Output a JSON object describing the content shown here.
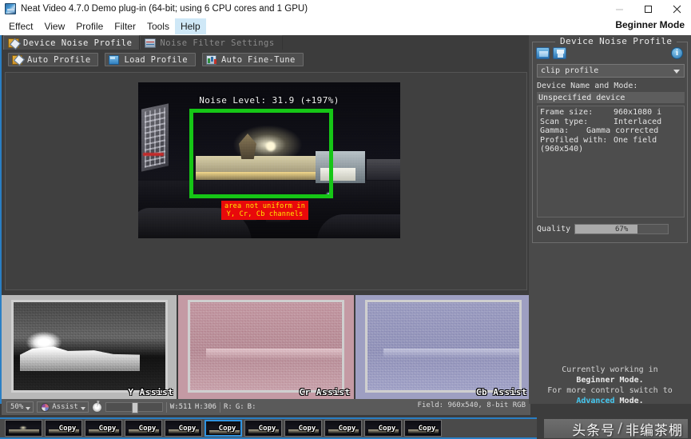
{
  "titlebar": {
    "title": "Neat Video 4.7.0  Demo plug-in (64-bit; using 6 CPU cores and 1 GPU)",
    "app_icon": "neat-video-icon",
    "minimize": "–",
    "maximize": "□",
    "close": "✕"
  },
  "menubar": {
    "items": [
      "Effect",
      "View",
      "Profile",
      "Filter",
      "Tools",
      "Help"
    ],
    "active_item": "Help",
    "mode_label": "Beginner Mode"
  },
  "tabs": [
    {
      "label": "Device Noise Profile",
      "icon": "profile-icon",
      "selected": true
    },
    {
      "label": "Noise Filter Settings",
      "icon": "filter-settings-icon",
      "selected": false
    }
  ],
  "toolbar_buttons": [
    {
      "label": "Auto Profile",
      "icon": "auto-profile-icon"
    },
    {
      "label": "Load Profile",
      "icon": "folder-open-icon"
    },
    {
      "label": "Auto Fine-Tune",
      "icon": "auto-fine-tune-icon"
    }
  ],
  "preview": {
    "noise_level_text": "Noise Level: 31.9 (+197%)",
    "noise_level_value": 31.9,
    "noise_level_percent": "+197%",
    "selection_color": "#16c616",
    "warning_line1": "area not uniform in",
    "warning_line2": "Y, Cr, Cb channels",
    "warning_bg": "#e8090b",
    "warning_fg": "#ffe800"
  },
  "assist_panes": [
    {
      "label": "Y Assist",
      "channel": "Y",
      "tint": "#b9b9b9"
    },
    {
      "label": "Cr Assist",
      "channel": "Cr",
      "tint": "#c49aa4"
    },
    {
      "label": "Cb Assist",
      "channel": "Cb",
      "tint": "#9e9fc2"
    }
  ],
  "statusbar": {
    "zoom": "50%",
    "view_mode": "Assist",
    "brightness_icon": "brightness-icon",
    "slider_value": 45,
    "width_label": "W:511",
    "height_label": "H:306",
    "r_label": "R:",
    "g_label": "G:",
    "b_label": "B:",
    "field_info": "Field: 960x540, 8-bit RGB"
  },
  "right_panel": {
    "group_title": "Device Noise Profile",
    "open_button": "open-profile-icon",
    "save_button": "save-profile-icon",
    "info_button": "i",
    "profile_select": "clip profile",
    "device_label": "Device Name and Mode:",
    "device_name": "Unspecified device",
    "info_rows": [
      {
        "key": "Frame size:",
        "value": "960x1080 i"
      },
      {
        "key": "Scan type:",
        "value": "Interlaced"
      },
      {
        "key": "Gamma:",
        "value": "Gamma corrected"
      },
      {
        "key": "Profiled with:",
        "value": "One field"
      },
      {
        "key": "(960x540)",
        "value": ""
      }
    ],
    "quality_label": "Quality",
    "quality_value": "67%",
    "quality_percent": 67,
    "mode_note_line1": "Currently working in",
    "mode_note_line2": "Beginner Mode.",
    "mode_note_line3": "For more control switch to",
    "mode_note_link": "Advanced",
    "mode_note_suffix": " Mode.",
    "accent_color": "#45c8f0"
  },
  "copy_row": {
    "items": [
      {
        "label": "",
        "selected": false
      },
      {
        "label": "Copy",
        "selected": false
      },
      {
        "label": "Copy",
        "selected": false
      },
      {
        "label": "Copy",
        "selected": false
      },
      {
        "label": "Copy",
        "selected": false
      },
      {
        "label": "Copy",
        "selected": true
      },
      {
        "label": "Copy",
        "selected": false
      },
      {
        "label": "Copy",
        "selected": false
      },
      {
        "label": "Copy",
        "selected": false
      },
      {
        "label": "Copy",
        "selected": false
      },
      {
        "label": "Copy",
        "selected": false
      }
    ]
  },
  "watermark": {
    "left": "头条号",
    "slash": "/",
    "right": "非编茶棚"
  }
}
